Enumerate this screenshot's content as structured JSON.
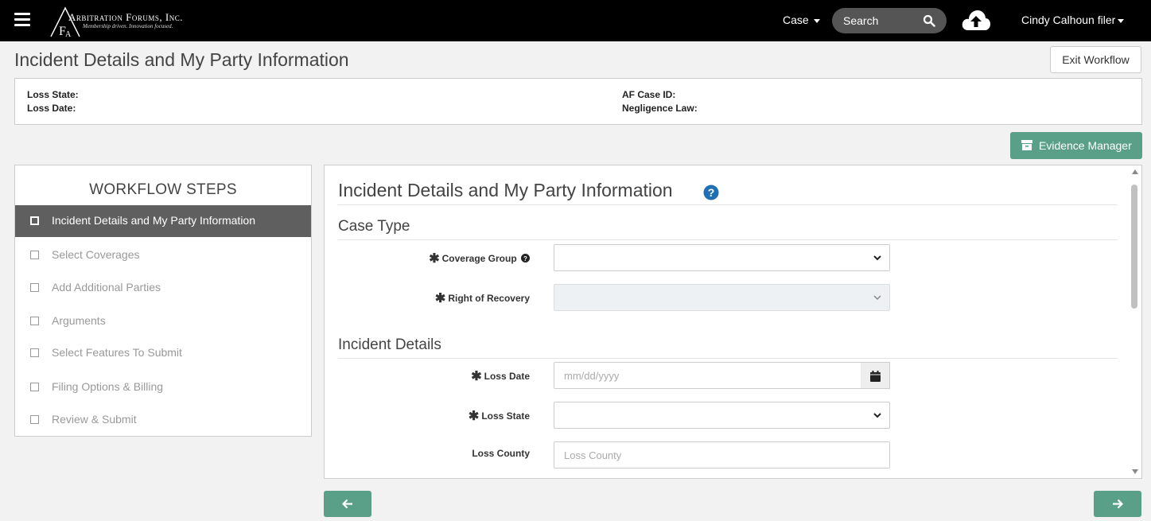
{
  "header": {
    "logo_name": "Arbitration Forums, Inc.",
    "logo_tagline": "Membership driven. Innovation focused.",
    "case_menu": "Case",
    "search_placeholder": "Search",
    "user_name": "Cindy Calhoun filer"
  },
  "page": {
    "title": "Incident Details and My Party Information",
    "exit_button": "Exit Workflow",
    "evidence_button": "Evidence Manager"
  },
  "info": {
    "loss_state_label": "Loss State:",
    "loss_date_label": "Loss Date:",
    "case_id_label": "AF Case ID:",
    "negligence_label": "Negligence Law:"
  },
  "workflow": {
    "title": "WORKFLOW STEPS",
    "steps": [
      {
        "label": "Incident Details and My Party Information",
        "active": true
      },
      {
        "label": "Select Coverages",
        "active": false
      },
      {
        "label": "Add Additional Parties",
        "active": false
      },
      {
        "label": "Arguments",
        "active": false
      },
      {
        "label": "Select Features To Submit",
        "active": false
      },
      {
        "label": "Filing Options & Billing",
        "active": false
      },
      {
        "label": "Review & Submit",
        "active": false
      }
    ]
  },
  "form": {
    "title": "Incident Details and My Party Information",
    "case_type_section": "Case Type",
    "coverage_group_label": "Coverage Group",
    "coverage_group_value": "",
    "right_of_recovery_label": "Right of Recovery",
    "right_of_recovery_value": "",
    "incident_section": "Incident Details",
    "loss_date_label": "Loss Date",
    "loss_date_placeholder": "mm/dd/yyyy",
    "loss_state_label": "Loss State",
    "loss_state_value": "",
    "loss_county_label": "Loss County",
    "loss_county_placeholder": "Loss County",
    "required_marker": "✱"
  },
  "colors": {
    "nav_bg": "#000000",
    "accent_green": "#5a9f88",
    "active_step_bg": "#5f5f5f",
    "help_blue": "#1f6fb2"
  },
  "icons": [
    "menu-icon",
    "search-icon",
    "cloud-upload-icon",
    "archive-icon",
    "help-icon",
    "calendar-icon",
    "arrow-left-icon",
    "arrow-right-icon"
  ]
}
